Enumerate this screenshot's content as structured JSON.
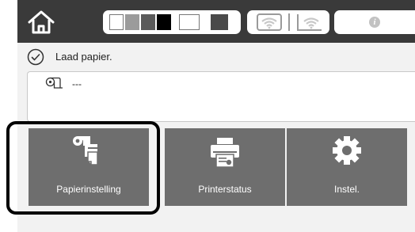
{
  "status_bar": {
    "icons": [
      "home-icon",
      "wifi-icon",
      "wifi-direct-icon",
      "info-icon"
    ],
    "info_glyph": "i",
    "ink_colors": [
      "#e8e8e8",
      "#9b9b9b",
      "#5a5a5a",
      "#000000",
      "#ffffff",
      "#4a4a4a"
    ]
  },
  "message": {
    "text": "Laad papier.",
    "icon": "check-circle-icon"
  },
  "paper_info": {
    "icon": "roll-paper-icon",
    "value": "---"
  },
  "tiles": [
    {
      "label": "Papierinstelling",
      "icon": "paper-setup-icon",
      "selected": true
    },
    {
      "label": "Printerstatus",
      "icon": "printer-status-icon",
      "selected": false
    },
    {
      "label": "Instel.",
      "icon": "gear-icon",
      "selected": false
    }
  ],
  "colors": {
    "status_bar_bg": "#3a3a3a",
    "tile_bg": "#6e6e6e",
    "screen_bg": "#f2f2f2",
    "focus_ring": "#000000"
  }
}
